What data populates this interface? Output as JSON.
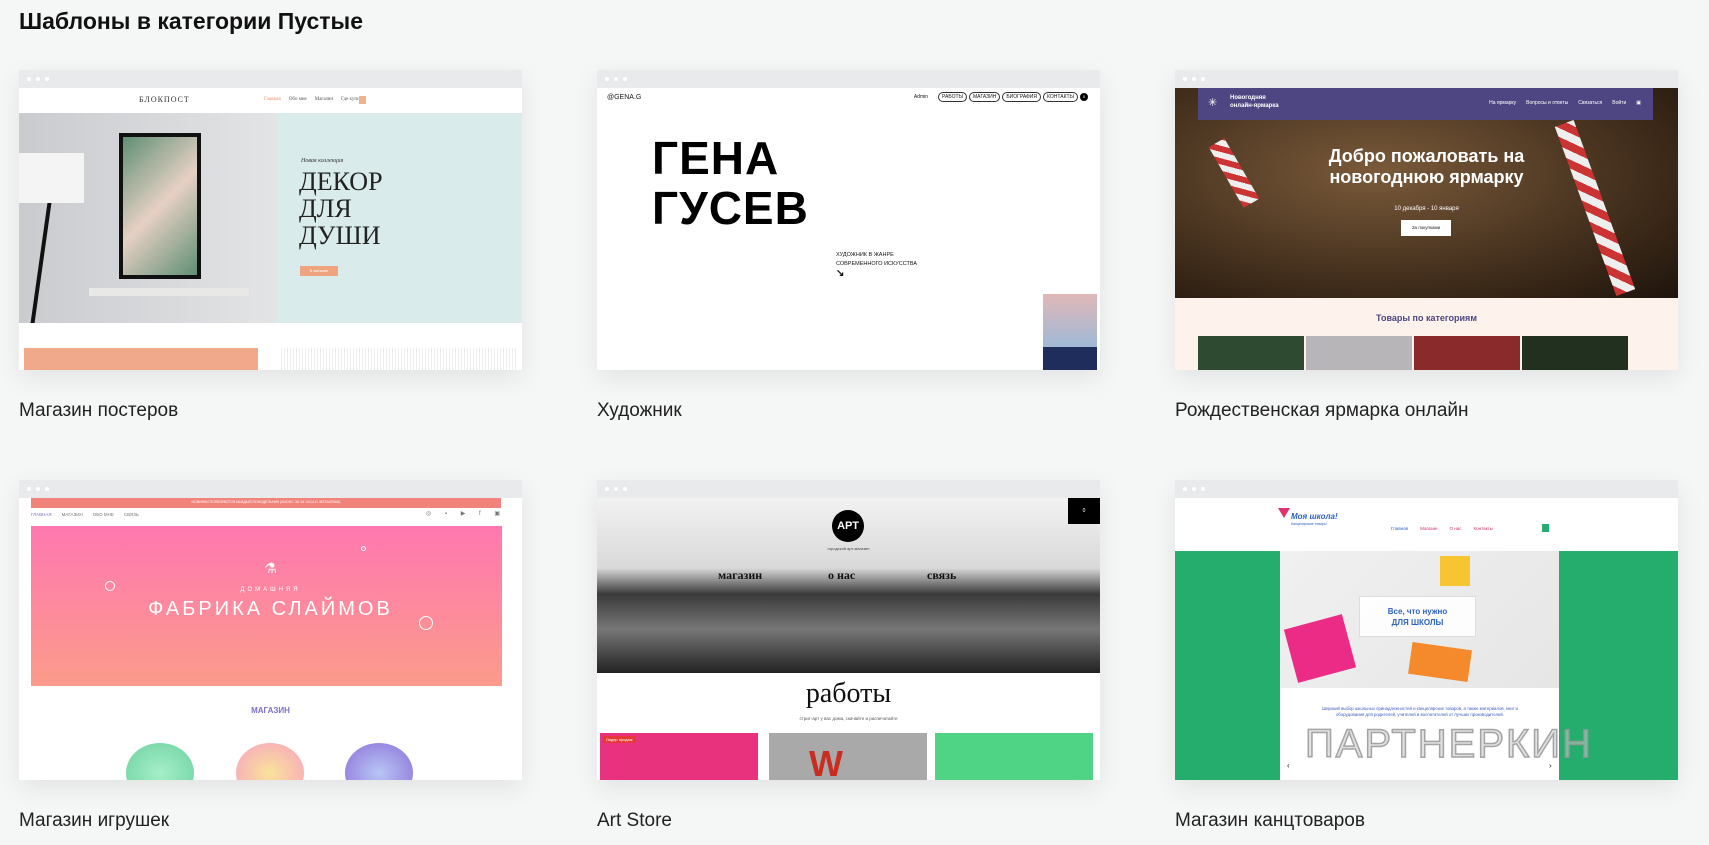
{
  "page_title": "Шаблоны в категории Пустые",
  "templates": [
    {
      "name": "Магазин постеров",
      "preview": {
        "logo": "БЛОКПОСТ",
        "nav": [
          "Главная",
          "Обо мне",
          "Магазин",
          "Где купить"
        ],
        "subtitle": "Новая коллекция",
        "headline_lines": [
          "ДЕКОР",
          "ДЛЯ",
          "ДУШИ"
        ],
        "button": "В магазин"
      }
    },
    {
      "name": "Художник",
      "preview": {
        "handle": "@GENA.G",
        "account": "Admin",
        "nav": [
          "РАБОТЫ",
          "МАГАЗИН",
          "БИОГРАФИЯ",
          "КОНТАКТЫ"
        ],
        "cart_count": "0",
        "headline_lines": [
          "ГЕНА",
          "ГУСЕВ"
        ],
        "subtitle_lines": [
          "ХУДОЖНИК В ЖАНРЕ",
          "СОВРЕМЕННОГО ИСКУССТВА"
        ]
      }
    },
    {
      "name": "Рождественская ярмарка онлайн",
      "preview": {
        "brand_lines": [
          "Новогодняя",
          "онлайн-ярмарка"
        ],
        "nav": [
          "На ярмарку",
          "Вопросы и ответы",
          "Связаться",
          "Войти"
        ],
        "headline_lines": [
          "Добро пожаловать на",
          "новогоднюю ярмарку"
        ],
        "dates": "10 декабря - 10 января",
        "button": "За покупками",
        "section_title": "Товары по категориям"
      }
    },
    {
      "name": "Магазин игрушек",
      "preview": {
        "banner": "НОВИНКИ ПОЯВЛЯЮТСЯ КАЖДЫЙ ПОНЕДЕЛЬНИК (АНОНС ЗА 24 ЧАСА В INSTAGRAM)",
        "nav": [
          "ГЛАВНАЯ",
          "МАГАЗИН",
          "ОБО МНЕ",
          "СВЯЗЬ"
        ],
        "kicker": "ДОМАШНЯЯ",
        "headline": "ФАБРИКА СЛАЙМОВ",
        "section_title": "МАГАЗИН"
      }
    },
    {
      "name": "Art Store",
      "preview": {
        "logo": "АРТ",
        "tagline": "городской арт-магазин",
        "cart_count": "0",
        "nav": [
          "магазин",
          "о нас",
          "связь"
        ],
        "section_title": "работы",
        "section_subtitle": "стрит-арт у вас дома, скачайте и распечатайте",
        "badge": "Лидер продаж"
      }
    },
    {
      "name": "Магазин канцтоваров",
      "preview": {
        "logo": "Моя школа!",
        "logo_sub": "Канцелярские товары",
        "nav": [
          "Главная",
          "Магазин",
          "О нас",
          "Контакты"
        ],
        "headline_lines": [
          "Все, что нужно",
          "ДЛЯ ШКОЛЫ"
        ],
        "description": "Широкий выбор школьных принадлежностей и канцелярских товаров, а также материалов, книг и оборудования для родителей, учителей и воспитателей от лучших производителей."
      }
    }
  ],
  "watermark": "ПАРТНЕРКИН"
}
